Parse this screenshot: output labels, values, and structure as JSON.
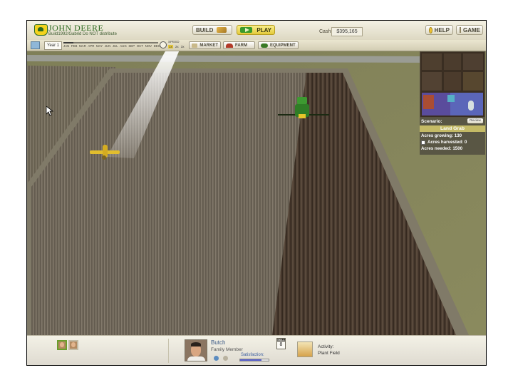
{
  "header": {
    "brand": "JOHN DEERE",
    "build_note": "Build1992/Gabrid Do NOT distribute",
    "build_label": "BUILD",
    "play_label": "PLAY",
    "cash_label": "Cash:",
    "cash_value": "$395,165",
    "help_label": "HELP",
    "game_label": "GAME"
  },
  "toolbar": {
    "year_label": "Year 1",
    "months": [
      "JAN",
      "FEB",
      "MAR",
      "APR",
      "MAY",
      "JUN",
      "JUL",
      "AUG",
      "SEP",
      "OCT",
      "NOV",
      "DEC"
    ],
    "speed_label": "SPEED",
    "speed_options": [
      "1x",
      "2x",
      "3x"
    ],
    "market_label": "MARKET",
    "farm_label": "FARM",
    "equipment_label": "EQUIPMENT"
  },
  "scenario": {
    "label": "Scenario:",
    "review_label": "Review",
    "title": "Land Grab",
    "acres_growing": "Acres growing: 130",
    "acres_harvested": "Acres harvested: 0",
    "acres_needed": "Acres needed: 1500"
  },
  "bottom": {
    "member_name": "Butch",
    "member_role": "Family Member",
    "satisfaction_label": "Satisfaction:",
    "satisfaction_fraction": 0.75,
    "skill_label": "SKILL",
    "skill_value": "8",
    "activity_label": "Activity:",
    "activity_value": "Plant Field"
  },
  "colors": {
    "brand_green": "#2c6a1f",
    "brand_yellow": "#f3d21d",
    "scenario_title_bg": "#c4ba66",
    "satisfaction_fill": "#5a63cf"
  }
}
